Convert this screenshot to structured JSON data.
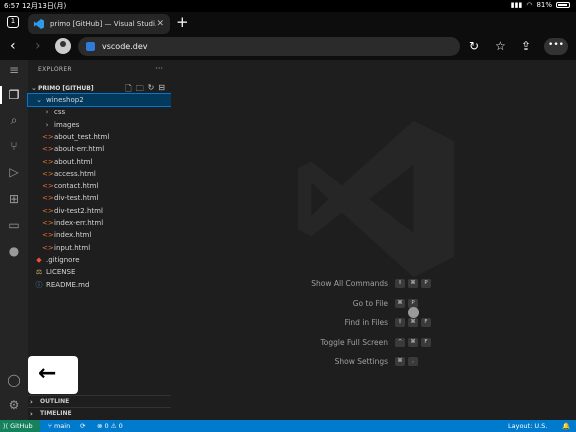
{
  "ios_status": {
    "time": "6:57",
    "date": "12月13日(月)",
    "battery": "81%"
  },
  "browser": {
    "tab_count": "1",
    "tab_title": "primo [GitHub] — Visual Studi...",
    "url": "vscode.dev"
  },
  "explorer": {
    "header": "EXPLORER",
    "section_title": "PRIMO [GITHUB]",
    "tree": [
      {
        "label": "wineshop2",
        "type": "folder-open",
        "depth": 0,
        "selected": true
      },
      {
        "label": "css",
        "type": "folder",
        "depth": 1
      },
      {
        "label": "images",
        "type": "folder",
        "depth": 1
      },
      {
        "label": "about_test.html",
        "type": "html",
        "depth": 1
      },
      {
        "label": "about-err.html",
        "type": "html",
        "depth": 1
      },
      {
        "label": "about.html",
        "type": "html",
        "depth": 1
      },
      {
        "label": "access.html",
        "type": "html",
        "depth": 1
      },
      {
        "label": "contact.html",
        "type": "html",
        "depth": 1
      },
      {
        "label": "div-test.html",
        "type": "html",
        "depth": 1
      },
      {
        "label": "div-test2.html",
        "type": "html",
        "depth": 1
      },
      {
        "label": "index-err.html",
        "type": "html",
        "depth": 1
      },
      {
        "label": "index.html",
        "type": "html",
        "depth": 1
      },
      {
        "label": "input.html",
        "type": "html",
        "depth": 1
      },
      {
        "label": ".gitignore",
        "type": "git",
        "depth": 0
      },
      {
        "label": "LICENSE",
        "type": "license",
        "depth": 0
      },
      {
        "label": "README.md",
        "type": "info",
        "depth": 0
      }
    ],
    "outline": "OUTLINE",
    "timeline": "TIMELINE"
  },
  "shortcuts": [
    {
      "label": "Show All Commands",
      "keys": [
        "⇧",
        "⌘",
        "P"
      ]
    },
    {
      "label": "Go to File",
      "keys": [
        "⌘",
        "P"
      ]
    },
    {
      "label": "Find in Files",
      "keys": [
        "⇧",
        "⌘",
        "F"
      ]
    },
    {
      "label": "Toggle Full Screen",
      "keys": [
        "^",
        "⌘",
        "F"
      ]
    },
    {
      "label": "Show Settings",
      "keys": [
        "⌘",
        ","
      ]
    }
  ],
  "statusbar": {
    "remote": "GitHub",
    "branch": "main",
    "problems": "⊗ 0 ⚠ 0",
    "layout": "Layout: U.S."
  },
  "colors": {
    "accent": "#007acc",
    "remote": "#16825d",
    "selected": "#04395e"
  }
}
